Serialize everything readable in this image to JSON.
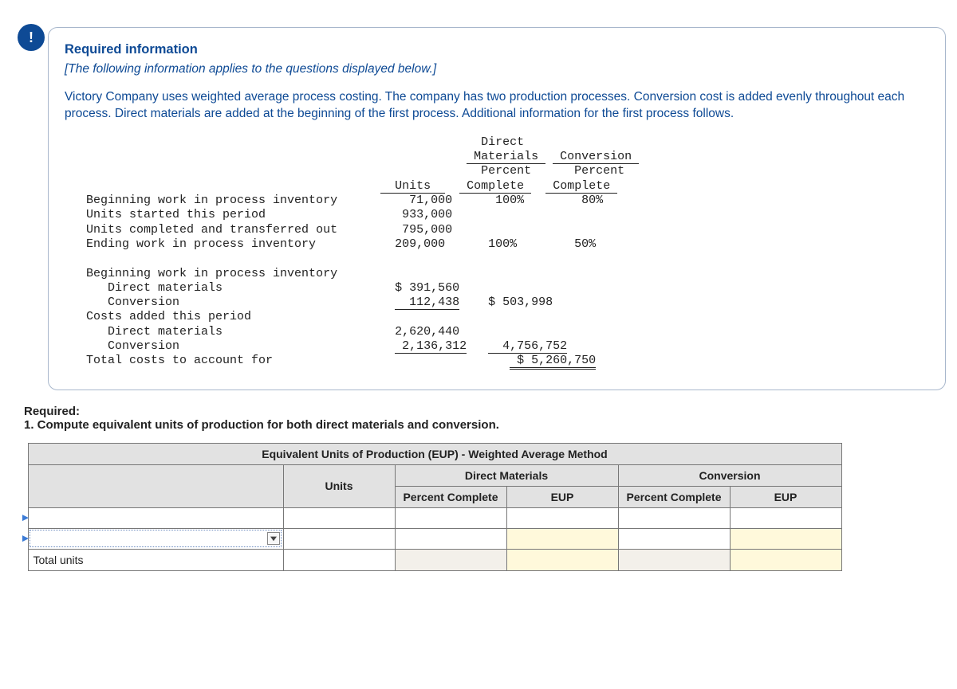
{
  "badge": "!",
  "heading": "Required information",
  "note": "[The following information applies to the questions displayed below.]",
  "intro": "Victory Company uses weighted average process costing. The company has two production processes. Conversion cost is added evenly throughout each process. Direct materials are added at the beginning of the first process. Additional information for the first process follows.",
  "units_table": {
    "col_units": "Units",
    "col_dm_top": "Direct",
    "col_dm_mid": "Materials",
    "col_dm_pct1": "Percent",
    "col_dm_pct2": "Complete",
    "col_cv_top": "Conversion",
    "col_cv_pct1": "Percent",
    "col_cv_pct2": "Complete",
    "r1l": "Beginning work in process inventory",
    "r1u": "71,000",
    "r1dm": "100%",
    "r1cv": "80%",
    "r2l": "Units started this period",
    "r2u": "933,000",
    "r3l": "Units completed and transferred out",
    "r3u": "795,000",
    "r4l": "Ending work in process inventory",
    "r4u": "209,000",
    "r4dm": "100%",
    "r4cv": "50%"
  },
  "cost_table": {
    "h1": "Beginning work in process inventory",
    "dm_l": "Direct materials",
    "dm_v": "$ 391,560",
    "cv_l": "Conversion",
    "cv_v": "112,438",
    "cv_sub": "$ 503,998",
    "h2": "Costs added this period",
    "dm2_v": "2,620,440",
    "cv2_v": "2,136,312",
    "cv2_sub": "4,756,752",
    "total_l": "Total costs to account for",
    "total_v": "$ 5,260,750"
  },
  "req_label": "Required:",
  "req_1": "1. Compute equivalent units of production for both direct materials and conversion.",
  "ans": {
    "title": "Equivalent Units of Production (EUP) - Weighted Average Method",
    "dm": "Direct Materials",
    "cv": "Conversion",
    "units": "Units",
    "pct": "Percent Complete",
    "eup": "EUP",
    "total": "Total units"
  }
}
